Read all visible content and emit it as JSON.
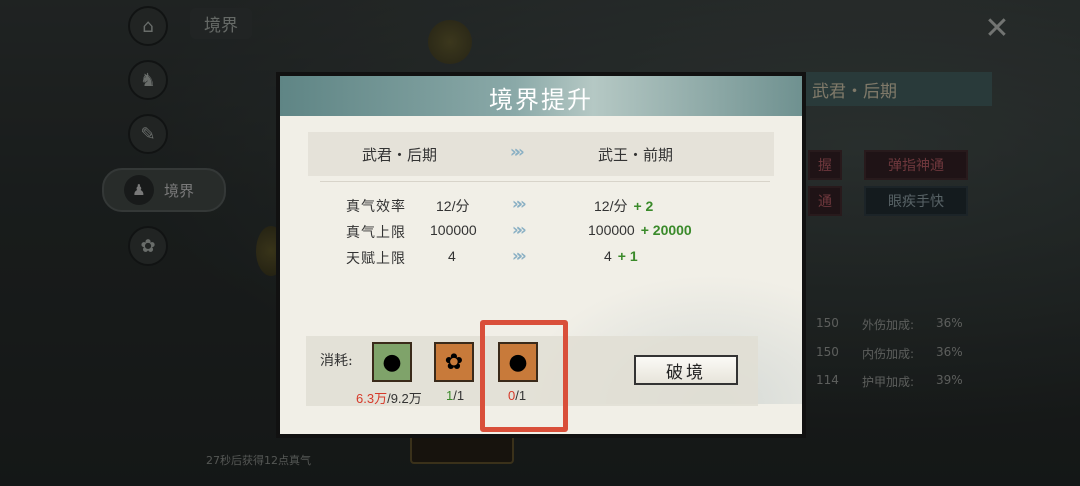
{
  "background": {
    "tab_label": "境界",
    "sidebar_active_label": "境界",
    "close_glyph": "✕",
    "right_panel_title": "武君・后期",
    "skills": [
      "握",
      "弹指神通",
      "通",
      "眼疾手快"
    ],
    "stats": [
      {
        "value": "150",
        "label": "外伤加成:",
        "pct": "36%"
      },
      {
        "value": "150",
        "label": "内伤加成:",
        "pct": "36%"
      },
      {
        "value": "114",
        "label": "护甲加成:",
        "pct": "39%"
      }
    ],
    "bottom_note": "27秒后获得12点真气"
  },
  "dialog": {
    "title": "境界提升",
    "from_level": "武君・后期",
    "to_level": "武王・前期",
    "arrow": "»»",
    "stats": [
      {
        "label": "真气效率",
        "current": "12/分",
        "next": "12/分",
        "plus": "+ 2"
      },
      {
        "label": "真气上限",
        "current": "100000",
        "next": "100000",
        "plus": "+ 20000"
      },
      {
        "label": "天赋上限",
        "current": "4",
        "next": "4",
        "plus": "+ 1"
      }
    ],
    "cost_label": "消耗:",
    "items": [
      {
        "icon": "orb-icon",
        "have": "6.3万",
        "need": "/9.2万"
      },
      {
        "icon": "flower-icon",
        "have": "1",
        "need": "/1"
      },
      {
        "icon": "peach-icon",
        "have": "0",
        "need": "/1"
      }
    ],
    "break_button": "破境"
  },
  "colors": {
    "highlight": "#d94f3a",
    "insufficient": "#d63a2a",
    "sufficient": "#3a8a2a",
    "title_bar": "#6f9190"
  }
}
